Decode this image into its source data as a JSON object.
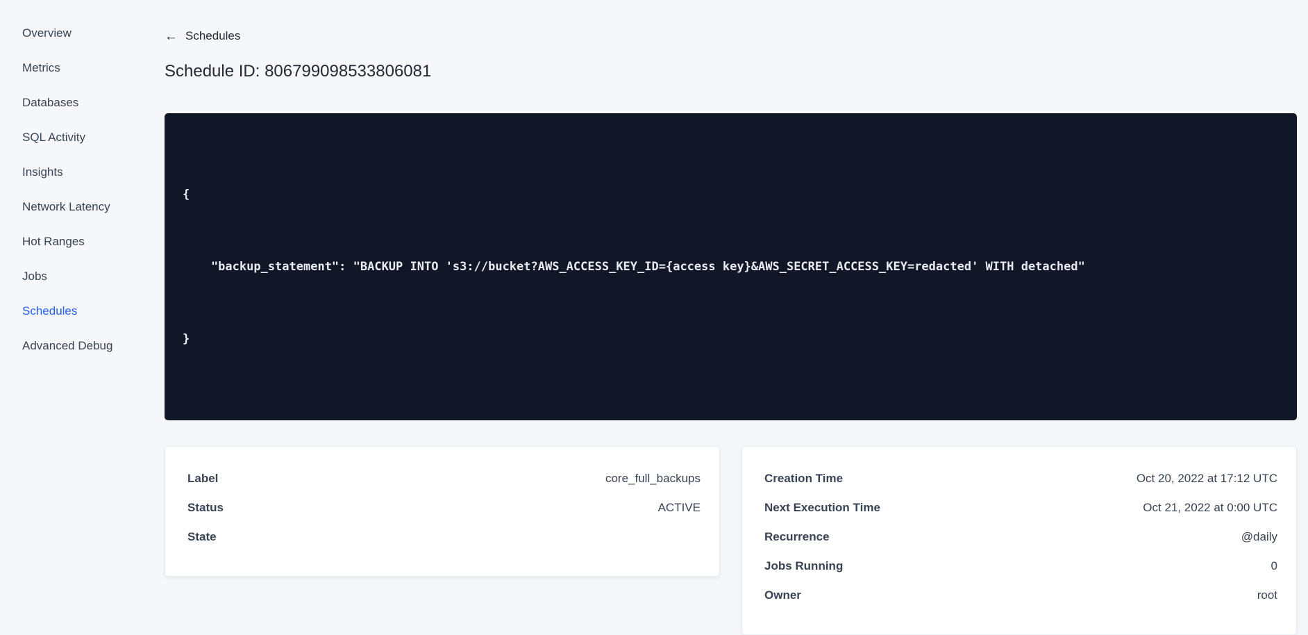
{
  "colors": {
    "page_bg": "#f5f7fa",
    "card_bg": "#ffffff",
    "card_border": "#e7ecf3",
    "code_bg": "#111726",
    "code_text": "#e7ecf3",
    "text_primary": "#242a35",
    "text_secondary": "#394455",
    "accent_active_link": "#2261f0"
  },
  "sidebar": {
    "items": [
      {
        "label": "Overview",
        "active": false
      },
      {
        "label": "Metrics",
        "active": false
      },
      {
        "label": "Databases",
        "active": false
      },
      {
        "label": "SQL Activity",
        "active": false
      },
      {
        "label": "Insights",
        "active": false
      },
      {
        "label": "Network Latency",
        "active": false
      },
      {
        "label": "Hot Ranges",
        "active": false
      },
      {
        "label": "Jobs",
        "active": false
      },
      {
        "label": "Schedules",
        "active": true
      },
      {
        "label": "Advanced Debug",
        "active": false
      }
    ]
  },
  "header": {
    "back_icon": "left-arrow",
    "back_arrow_glyph": "←",
    "back_label": "Schedules",
    "title": "Schedule ID: 806799098533806081"
  },
  "code_block": {
    "lines": [
      "{",
      "    \"backup_statement\": \"BACKUP INTO 's3://bucket?AWS_ACCESS_KEY_ID={access key}&AWS_SECRET_ACCESS_KEY=redacted' WITH detached\"",
      "}"
    ]
  },
  "detail_card": {
    "rows": [
      {
        "label": "Label",
        "value": "core_full_backups"
      },
      {
        "label": "Status",
        "value": "ACTIVE"
      },
      {
        "label": "State",
        "value": ""
      }
    ]
  },
  "schedule_card": {
    "rows": [
      {
        "label": "Creation Time",
        "value": "Oct 20, 2022 at 17:12 UTC"
      },
      {
        "label": "Next Execution Time",
        "value": "Oct 21, 2022 at 0:00 UTC"
      },
      {
        "label": "Recurrence",
        "value": "@daily"
      },
      {
        "label": "Jobs Running",
        "value": "0"
      },
      {
        "label": "Owner",
        "value": "root"
      }
    ]
  }
}
